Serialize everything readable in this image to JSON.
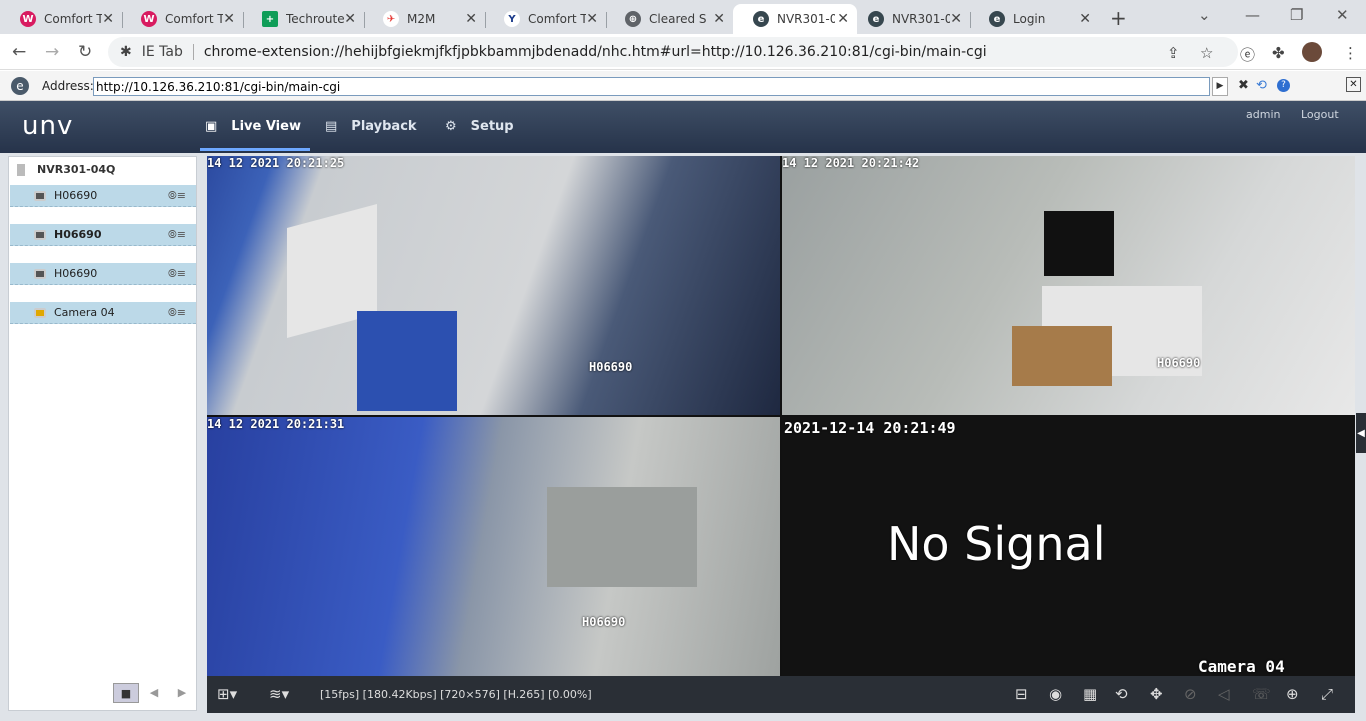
{
  "browser": {
    "tabs": [
      {
        "title": "Comfort Te",
        "fav_color": "#d81b60",
        "fav_glyph": "W"
      },
      {
        "title": "Comfort Te",
        "fav_color": "#d81b60",
        "fav_glyph": "W"
      },
      {
        "title": "Techroutel",
        "fav_color": "#0f9d58",
        "fav_glyph": "+"
      },
      {
        "title": "M2M",
        "fav_color": "#e53935",
        "fav_glyph": "✈"
      },
      {
        "title": "Comfort Te",
        "fav_color": "#1a3a8a",
        "fav_glyph": "Y"
      },
      {
        "title": "Cleared Se",
        "fav_color": "#5f6368",
        "fav_glyph": "⊕"
      },
      {
        "title": "NVR301-0",
        "fav_color": "#37474f",
        "fav_glyph": "e"
      },
      {
        "title": "NVR301-0",
        "fav_color": "#37474f",
        "fav_glyph": "e"
      },
      {
        "title": "Login",
        "fav_color": "#37474f",
        "fav_glyph": "e"
      }
    ],
    "url_prefix": "IE Tab",
    "url": "chrome-extension://hehijbfgiekmjfkfjpbkbammjbdenadd/nhc.htm#url=http://10.126.36.210:81/cgi-bin/main-cgi"
  },
  "ietab": {
    "address_label": "Address:",
    "address_value": "http://10.126.36.210:81/cgi-bin/main-cgi"
  },
  "app": {
    "logo": "unv",
    "menu": [
      {
        "label": "Live View",
        "icon": "monitor-icon"
      },
      {
        "label": "Playback",
        "icon": "film-icon"
      },
      {
        "label": "Setup",
        "icon": "gear-icon"
      }
    ],
    "user": "admin",
    "logout": "Logout"
  },
  "device_tree": {
    "nvr_name": "NVR301-04Q",
    "cameras": [
      {
        "name": "H06690",
        "bold": false
      },
      {
        "name": "H06690",
        "bold": true
      },
      {
        "name": "H06690",
        "bold": false
      },
      {
        "name": "Camera 04",
        "bold": false
      }
    ]
  },
  "video": {
    "panes": [
      {
        "timestamp": "14 12 2021  20:21:25",
        "label": "H06690"
      },
      {
        "timestamp": "14 12 2021  20:21:42",
        "label": "H06690"
      },
      {
        "timestamp": "14 12 2021  20:21:31",
        "label": "H06690"
      },
      {
        "timestamp": "2021-12-14  20:21:49",
        "label": "Camera  04",
        "message": "No  Signal"
      }
    ],
    "stream_info": "[15fps] [180.42Kbps] [720×576] [H.265] [0.00%]"
  }
}
